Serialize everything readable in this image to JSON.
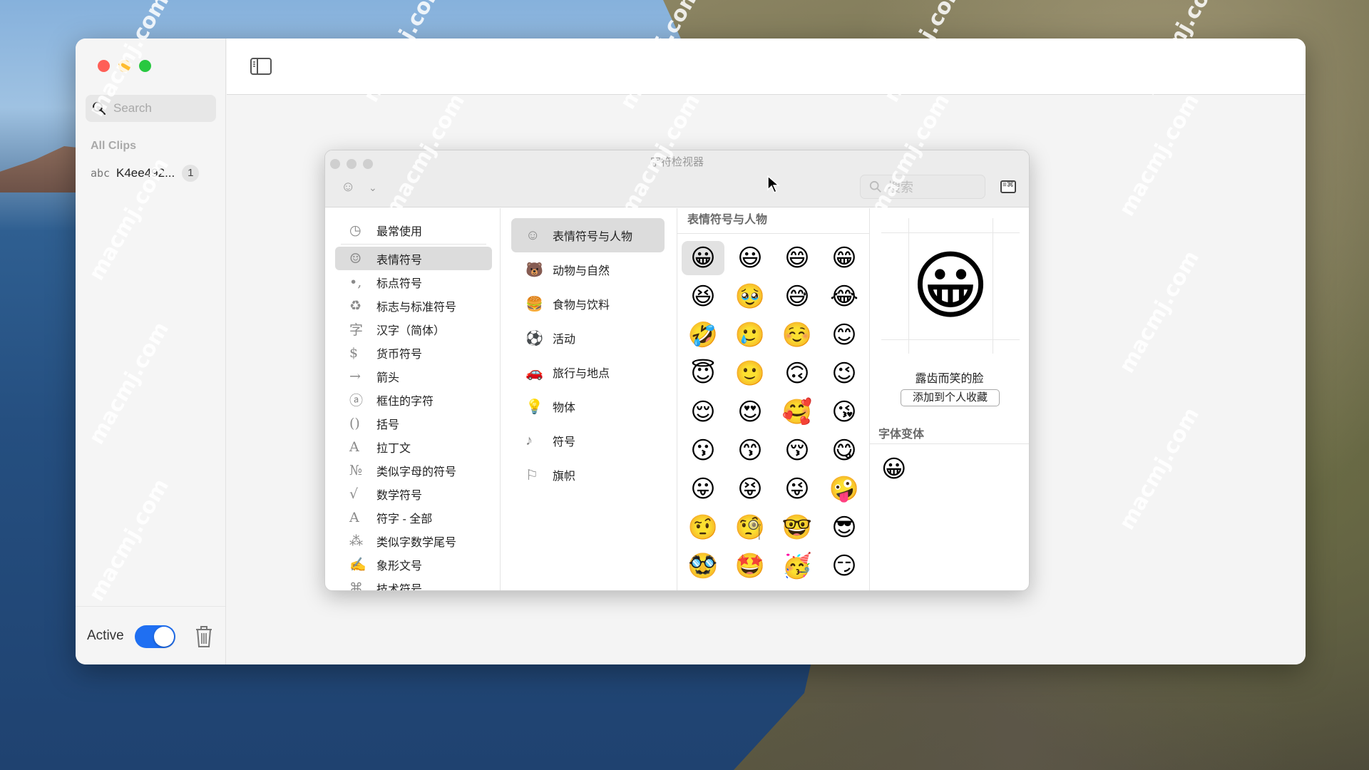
{
  "desktop": {
    "watermark_text": "macmj.com"
  },
  "app": {
    "sidebar": {
      "search_placeholder": "Search",
      "section_label": "All Clips",
      "clips": [
        {
          "icon": "abc",
          "name": "K4ee492...",
          "count": "1"
        }
      ],
      "footer": {
        "active_label": "Active",
        "active_toggle_on": true
      }
    }
  },
  "character_viewer": {
    "title": "字符检视器",
    "search_placeholder": "搜索",
    "categories": [
      {
        "icon": "◷",
        "icon_name": "clock-icon",
        "label": "最常使用",
        "selected": false
      },
      {
        "icon": "☺",
        "icon_name": "smiley-icon",
        "label": "表情符号",
        "selected": true
      },
      {
        "icon": "•,",
        "icon_name": "punctuation-icon",
        "label": "标点符号",
        "selected": false
      },
      {
        "icon": "♻",
        "icon_name": "recycle-icon",
        "label": "标志与标准符号",
        "selected": false
      },
      {
        "icon": "字",
        "icon_name": "hanzi-icon",
        "label": "汉字（简体）",
        "selected": false
      },
      {
        "icon": "$",
        "icon_name": "dollar-icon",
        "label": "货币符号",
        "selected": false
      },
      {
        "icon": "→",
        "icon_name": "arrow-icon",
        "label": "箭头",
        "selected": false
      },
      {
        "icon": "ⓐ",
        "icon_name": "circled-a-icon",
        "label": "框住的字符",
        "selected": false
      },
      {
        "icon": "()",
        "icon_name": "parentheses-icon",
        "label": "括号",
        "selected": false
      },
      {
        "icon": "A",
        "icon_name": "latin-a-icon",
        "label": "拉丁文",
        "selected": false
      },
      {
        "icon": "№",
        "icon_name": "numero-icon",
        "label": "类似字母的符号",
        "selected": false
      },
      {
        "icon": "√",
        "icon_name": "math-icon",
        "label": "数学符号",
        "selected": false
      },
      {
        "icon": "A",
        "icon_name": "all-characters-icon",
        "label": "符字 - 全部",
        "selected": false
      },
      {
        "icon": "⁂",
        "icon_name": "digit-symbol-icon",
        "label": "类似字数学尾号",
        "selected": false
      },
      {
        "icon": "✍",
        "icon_name": "pictograph-icon",
        "label": "象形文号",
        "selected": false
      },
      {
        "icon": "⌘",
        "icon_name": "command-icon",
        "label": "技术符号",
        "selected": false
      }
    ],
    "subcategories": [
      {
        "icon": "☺",
        "icon_name": "smiley-icon",
        "label": "表情符号与人物",
        "selected": true
      },
      {
        "icon": "🐻",
        "icon_name": "bear-icon",
        "label": "动物与自然",
        "selected": false
      },
      {
        "icon": "🍔",
        "icon_name": "food-icon",
        "label": "食物与饮料",
        "selected": false
      },
      {
        "icon": "⚽",
        "icon_name": "soccer-ball-icon",
        "label": "活动",
        "selected": false
      },
      {
        "icon": "🚗",
        "icon_name": "travel-icon",
        "label": "旅行与地点",
        "selected": false
      },
      {
        "icon": "💡",
        "icon_name": "lightbulb-icon",
        "label": "物体",
        "selected": false
      },
      {
        "icon": "♪",
        "icon_name": "symbols-icon",
        "label": "符号",
        "selected": false
      },
      {
        "icon": "⚐",
        "icon_name": "flag-icon",
        "label": "旗帜",
        "selected": false
      }
    ],
    "grid_header": "表情符号与人物",
    "emojis": [
      "😀",
      "😃",
      "😄",
      "😁",
      "😆",
      "🥹",
      "😅",
      "😂",
      "🤣",
      "🥲",
      "☺️",
      "😊",
      "😇",
      "🙂",
      "🙃",
      "😉",
      "😌",
      "😍",
      "🥰",
      "😘",
      "😗",
      "😙",
      "😚",
      "😋",
      "😛",
      "😝",
      "😜",
      "🤪",
      "🤨",
      "🧐",
      "🤓",
      "😎",
      "🥸",
      "🤩",
      "🥳",
      "😏"
    ],
    "selected_emoji_index": 0,
    "detail": {
      "emoji": "😀",
      "name": "露齿而笑的脸",
      "add_favorite_label": "添加到个人收藏",
      "variants_label": "字体变体",
      "variants": [
        "😀"
      ]
    }
  }
}
